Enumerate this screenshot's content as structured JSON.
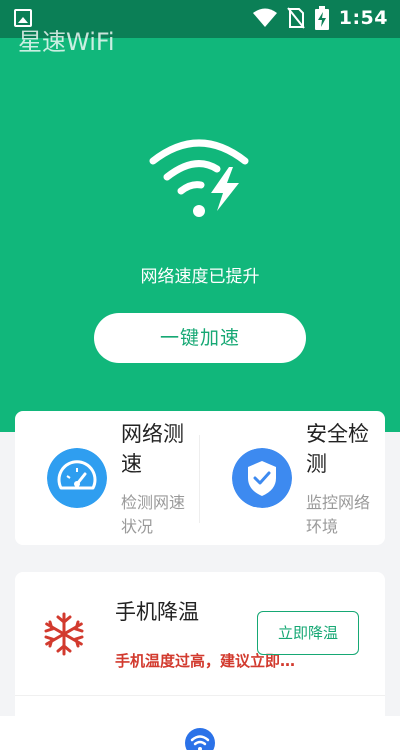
{
  "status_bar": {
    "time": "1:54",
    "icons": [
      "image-icon",
      "wifi-icon",
      "no-sim-icon",
      "battery-charging-icon"
    ]
  },
  "app": {
    "title": "星速WiFi"
  },
  "hero": {
    "status_text": "网络速度已提升",
    "boost_label": "一键加速",
    "icon": "wifi-bolt-icon"
  },
  "features": [
    {
      "title": "网络测速",
      "desc": "检测网速状况",
      "icon": "speedometer-icon",
      "color": "#2f9ef0"
    },
    {
      "title": "安全检测",
      "desc": "监控网络环境",
      "icon": "shield-check-icon",
      "color": "#3d8af0"
    }
  ],
  "cooling": {
    "title": "手机降温",
    "desc": "手机温度过高，建议立即…",
    "button": "立即降温",
    "icon": "snowflake-icon"
  },
  "bottom_nav": {
    "icon": "wifi-nav-icon"
  },
  "colors": {
    "primary": "#11b77b",
    "status_bar": "#0b7f56",
    "warning": "#d23a2e",
    "blue": "#2b72e8"
  }
}
